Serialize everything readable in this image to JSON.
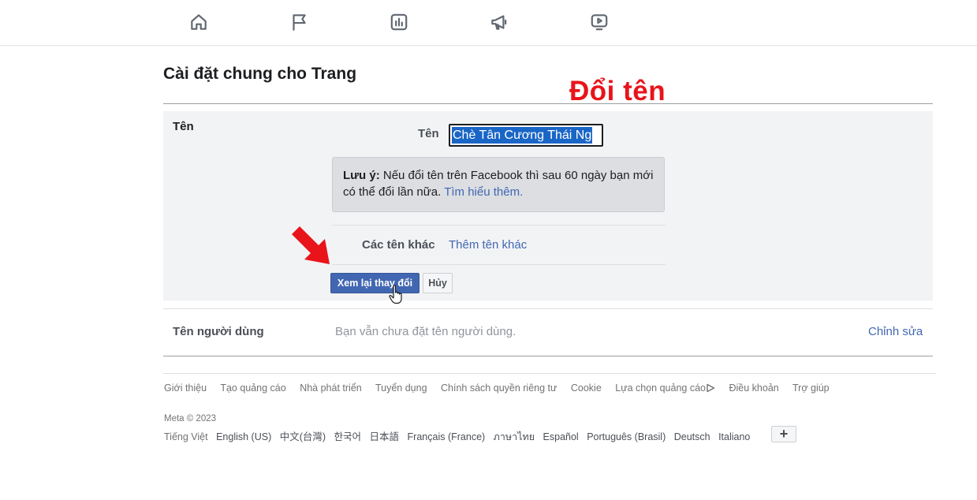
{
  "nav": {
    "icons": [
      "home-icon",
      "flag-icon",
      "insights-icon",
      "megaphone-icon",
      "video-icon"
    ]
  },
  "page": {
    "title": "Cài đặt chung cho Trang",
    "overlay_caption": "Đổi tên"
  },
  "name_section": {
    "label": "Tên",
    "field_label": "Tên",
    "field_value": "Chè Tân Cương Thái Ng",
    "note_bold": "Lưu ý:",
    "note_text": " Nếu đổi tên trên Facebook thì sau 60 ngày bạn mới có thể đổi lần nữa. ",
    "note_link": "Tìm hiểu thêm.",
    "other_names_label": "Các tên khác",
    "add_other_link": "Thêm tên khác",
    "review_button": "Xem lại thay đổi",
    "cancel_button": "Hủy"
  },
  "username_section": {
    "label": "Tên người dùng",
    "value": "Bạn vẫn chưa đặt tên người dùng.",
    "edit_link": "Chỉnh sửa"
  },
  "footer": {
    "links": [
      "Giới thiệu",
      "Tạo quảng cáo",
      "Nhà phát triển",
      "Tuyển dụng",
      "Chính sách quyền riêng tư",
      "Cookie",
      "Lựa chọn quảng cáo",
      "Điều khoản",
      "Trợ giúp"
    ],
    "copyright": "Meta © 2023",
    "current_language": "Tiếng Việt",
    "languages": [
      "English (US)",
      "中文(台灣)",
      "한국어",
      "日本語",
      "Français (France)",
      "ภาษาไทย",
      "Español",
      "Português (Brasil)",
      "Deutsch",
      "Italiano"
    ],
    "more_languages": "+"
  },
  "colors": {
    "accent": "#4267b2",
    "annotation_red": "#e8141a",
    "panel_bg": "#f2f3f5"
  }
}
